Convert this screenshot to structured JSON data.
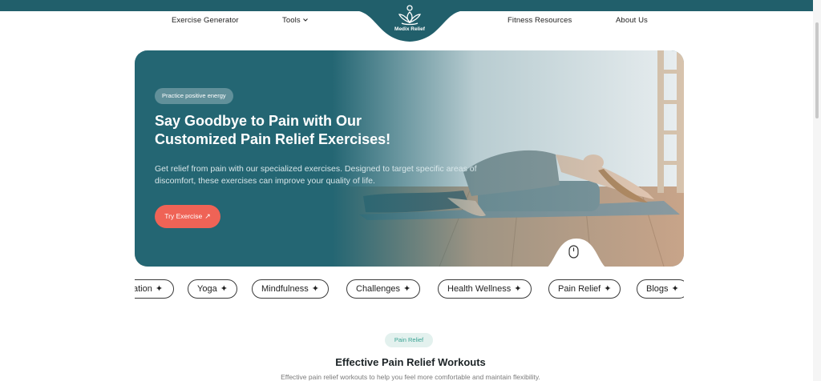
{
  "nav": {
    "links": [
      "Exercise Generator",
      "Tools",
      "Fitness Resources",
      "About Us"
    ],
    "logo_text": "Medix Relief"
  },
  "hero": {
    "badge": "Practice positive energy",
    "title": "Say Goodbye to Pain with Our Customized Pain Relief Exercises!",
    "description": "Get relief from pain with our specialized exercises. Designed to target specific areas of discomfort, these exercises can improve your quality of life.",
    "cta_label": "Try Exercise",
    "scroll_icon": "mouse-icon"
  },
  "tags": [
    "ation",
    "Yoga",
    "Mindfulness",
    "Challenges",
    "Health Wellness",
    "Pain Relief",
    "Blogs"
  ],
  "section": {
    "pill": "Pain Relief",
    "title": "Effective Pain Relief Workouts",
    "subtitle": "Effective pain relief workouts to help you feel more comfortable and maintain flexibility."
  },
  "colors": {
    "brand_teal": "#215f6b",
    "accent_coral": "#ef6356",
    "pill_bg": "#e3f1ee",
    "pill_text": "#3aa394"
  }
}
